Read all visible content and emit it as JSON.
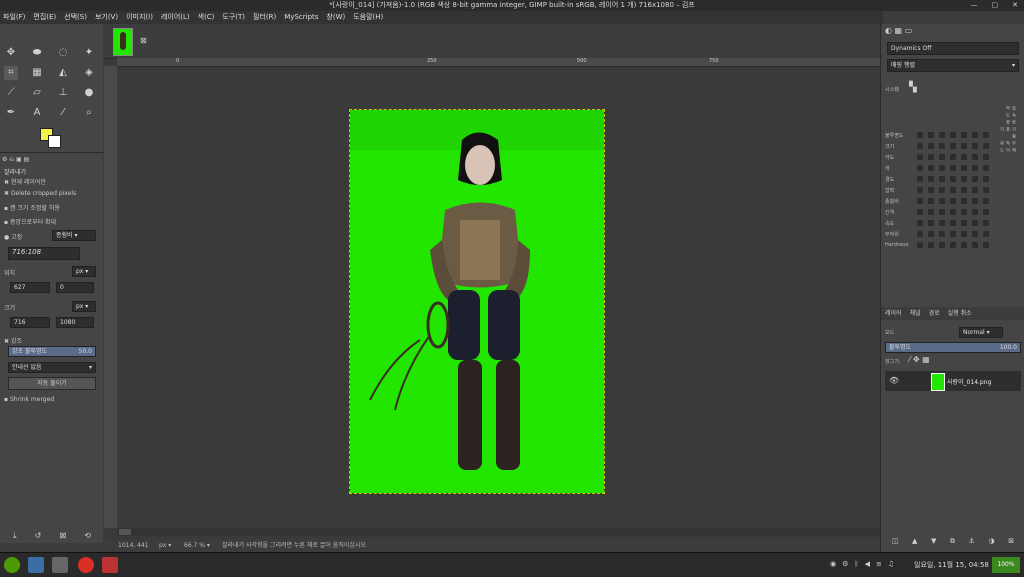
{
  "window": {
    "title": "*[사랑이_014] (가져옴)-1.0 (RGB 색상 8-bit gamma integer, GIMP built-in sRGB, 레이어 1 개) 716x1080 – 김프"
  },
  "menu": [
    "파일(F)",
    "편집(E)",
    "선택(S)",
    "보기(V)",
    "이미지(I)",
    "레이어(L)",
    "색(C)",
    "도구(T)",
    "필터(R)",
    "MyScripts",
    "창(W)",
    "도움말(H)"
  ],
  "tool_options": {
    "title": "잘라내기",
    "current_layer_only": "현재 레이어만",
    "delete_pixels": "Delete cropped pixels",
    "allow_growing": "캔 크기 조정할 허용",
    "expand_center": "중앙으로부터 확대",
    "fixed_label": "고정",
    "fixed_mode": "종횡비",
    "ratio_value": "716:108",
    "position_label": "위치",
    "position_unit": "px",
    "pos_x": "627",
    "pos_y": "0",
    "size_label": "크기",
    "size_unit": "px",
    "size_w": "716",
    "size_h": "1080",
    "highlight_label": "강조",
    "highlight_opacity_label": "강조 불투명도",
    "highlight_opacity_value": "50.0",
    "guides": "안내선 없음",
    "auto_shrink": "자동 줄이기",
    "shrink_merged": "Shrink merged"
  },
  "ruler": {
    "marks": [
      "0",
      "250",
      "500",
      "750"
    ]
  },
  "status": {
    "coords": "1014, 441",
    "unit": "px",
    "zoom": "66.7 %",
    "message": "잘라내기 사각형을 그리려면 누른 채로 끌어 움직이십시오"
  },
  "dynamics": {
    "header": "Dynamics Off",
    "mapping": "매핑 행렬",
    "rows": [
      "불투명도",
      "크기",
      "각도",
      "색",
      "경도",
      "압력",
      "종횡비",
      "간격",
      "속도",
      "무작위",
      "Hardness"
    ],
    "cols": [
      "압력",
      "속도",
      "방향",
      "기울기",
      "휠",
      "무작위",
      "페이드"
    ],
    "apply_label": "시스템"
  },
  "layers_panel": {
    "tabs": [
      "레이어",
      "채널",
      "경로",
      "실행 취소"
    ],
    "mode_label": "모드",
    "mode_value": "Normal",
    "opacity_label": "불투명도",
    "opacity_value": "100.0",
    "lock_label": "잠그기:",
    "layer_name": "사랑이_014.png"
  },
  "taskbar": {
    "clock": "일요일, 11월 15, 04:58",
    "battery": "100%"
  },
  "colors": {
    "canvas_green": "#22e600",
    "fg_color": "#f4f04a",
    "bg_color": "#ffffff"
  }
}
